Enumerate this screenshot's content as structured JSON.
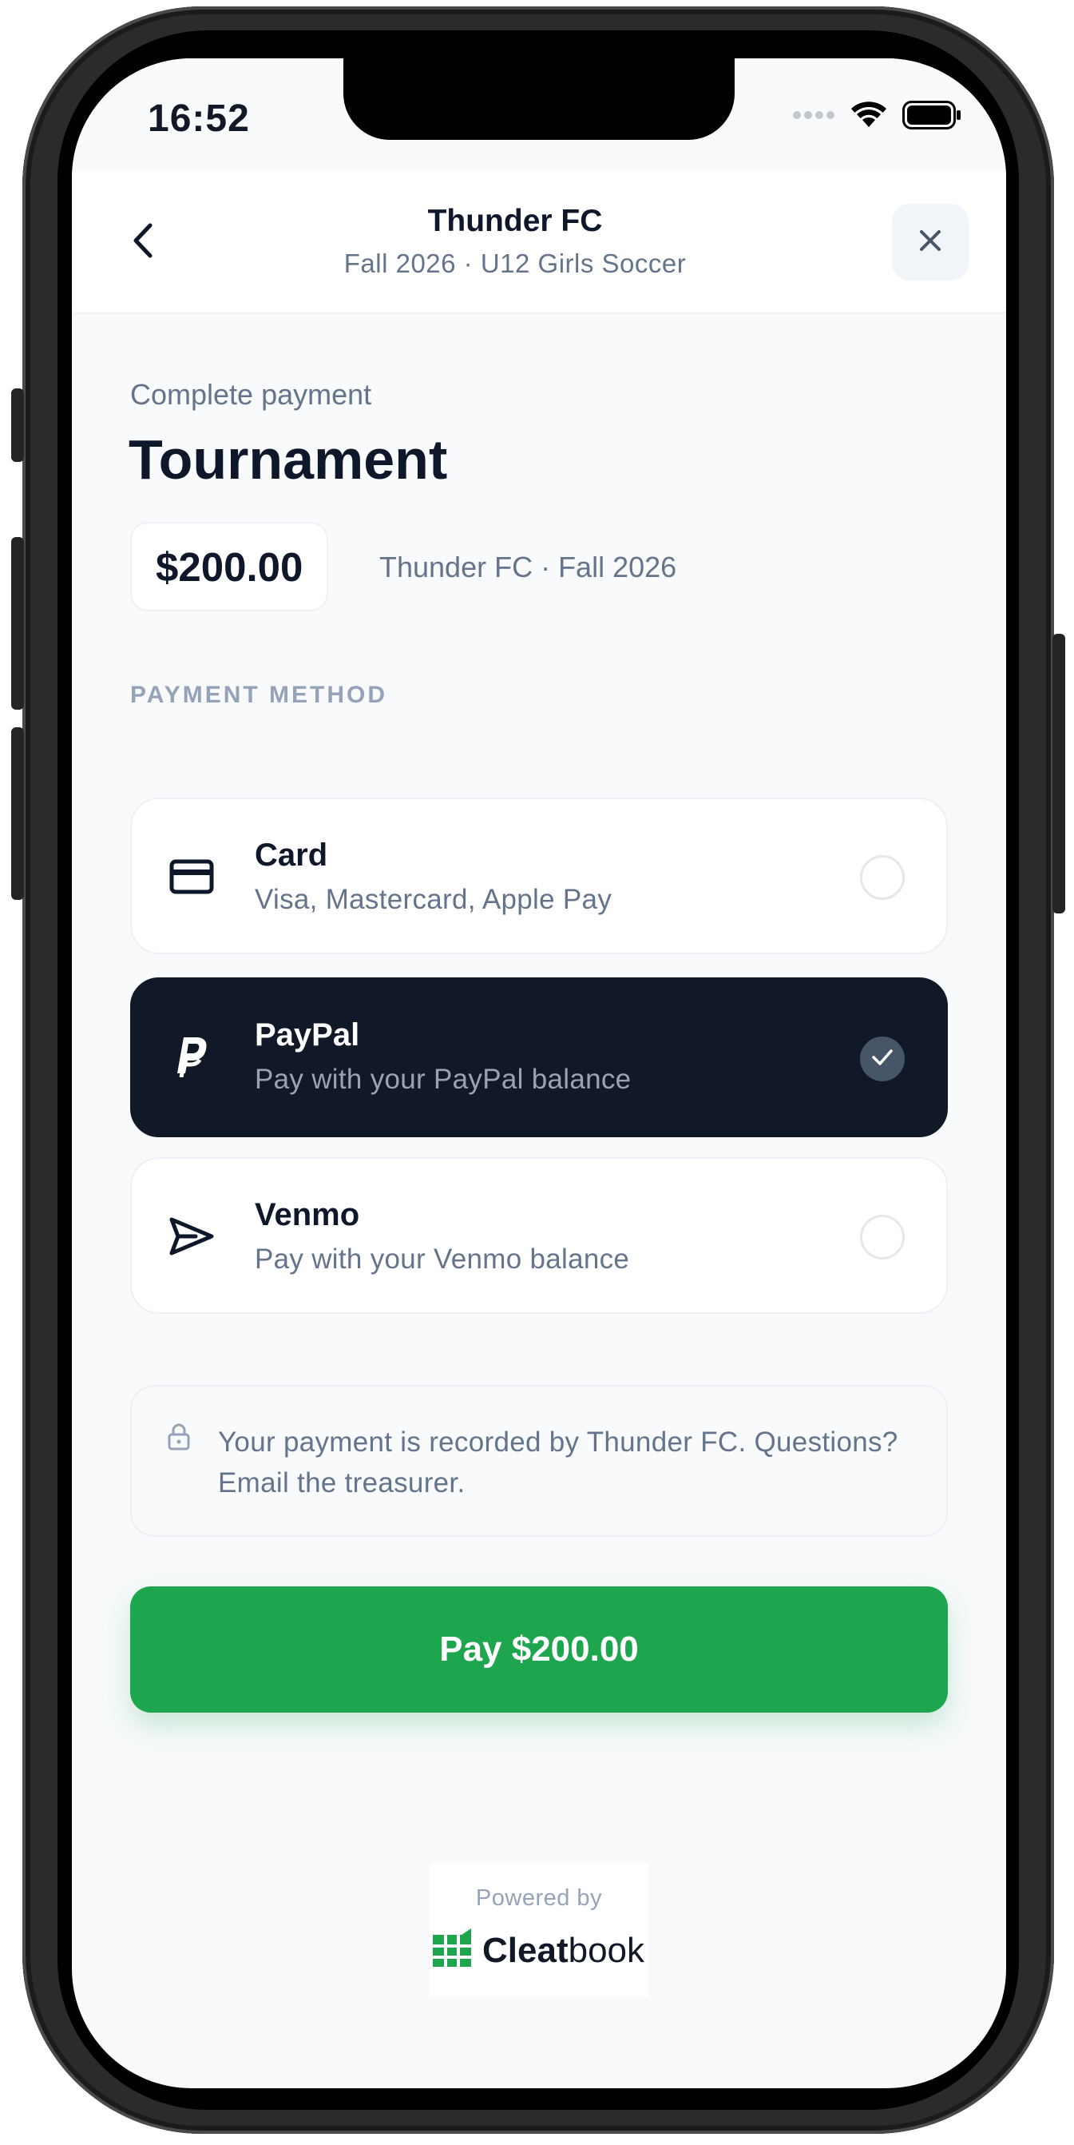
{
  "status_bar": {
    "time": "16:52",
    "icons": [
      "signal-dots-icon",
      "wifi-icon",
      "battery-icon"
    ]
  },
  "header": {
    "title": "Thunder FC",
    "subtitle": "Fall 2026 · U12 Girls Soccer",
    "back_icon": "chevron-left-icon",
    "close_icon": "close-icon"
  },
  "payment": {
    "eyebrow": "Complete payment",
    "item_title": "Tournament",
    "amount": "$200.00",
    "amount_context": "Thunder FC · Fall 2026"
  },
  "methods_section": {
    "label": "PAYMENT METHOD",
    "selected": "PayPal",
    "items": [
      {
        "name": "Card",
        "description": "Visa, Mastercard, Apple Pay",
        "icon": "credit-card-icon",
        "selected": false
      },
      {
        "name": "PayPal",
        "description": "Pay with your PayPal balance",
        "icon": "paypal-icon",
        "selected": true
      },
      {
        "name": "Venmo",
        "description": "Pay with your Venmo balance",
        "icon": "send-icon",
        "selected": false
      }
    ]
  },
  "notice": {
    "icon": "lock-icon",
    "text": "Your payment is recorded by Thunder FC. Questions? Email the treasurer."
  },
  "pay_button": {
    "label": "Pay $200.00"
  },
  "footer": {
    "powered_by": "Powered by",
    "brand_bold": "Cleat",
    "brand_light": "book",
    "brand_icon": "cleatbook-logo-icon"
  },
  "colors": {
    "accent_green": "#1ea64f",
    "selected_dark": "#111827",
    "text_primary": "#0f172a",
    "text_secondary": "#64748b",
    "muted": "#94a3b8"
  }
}
